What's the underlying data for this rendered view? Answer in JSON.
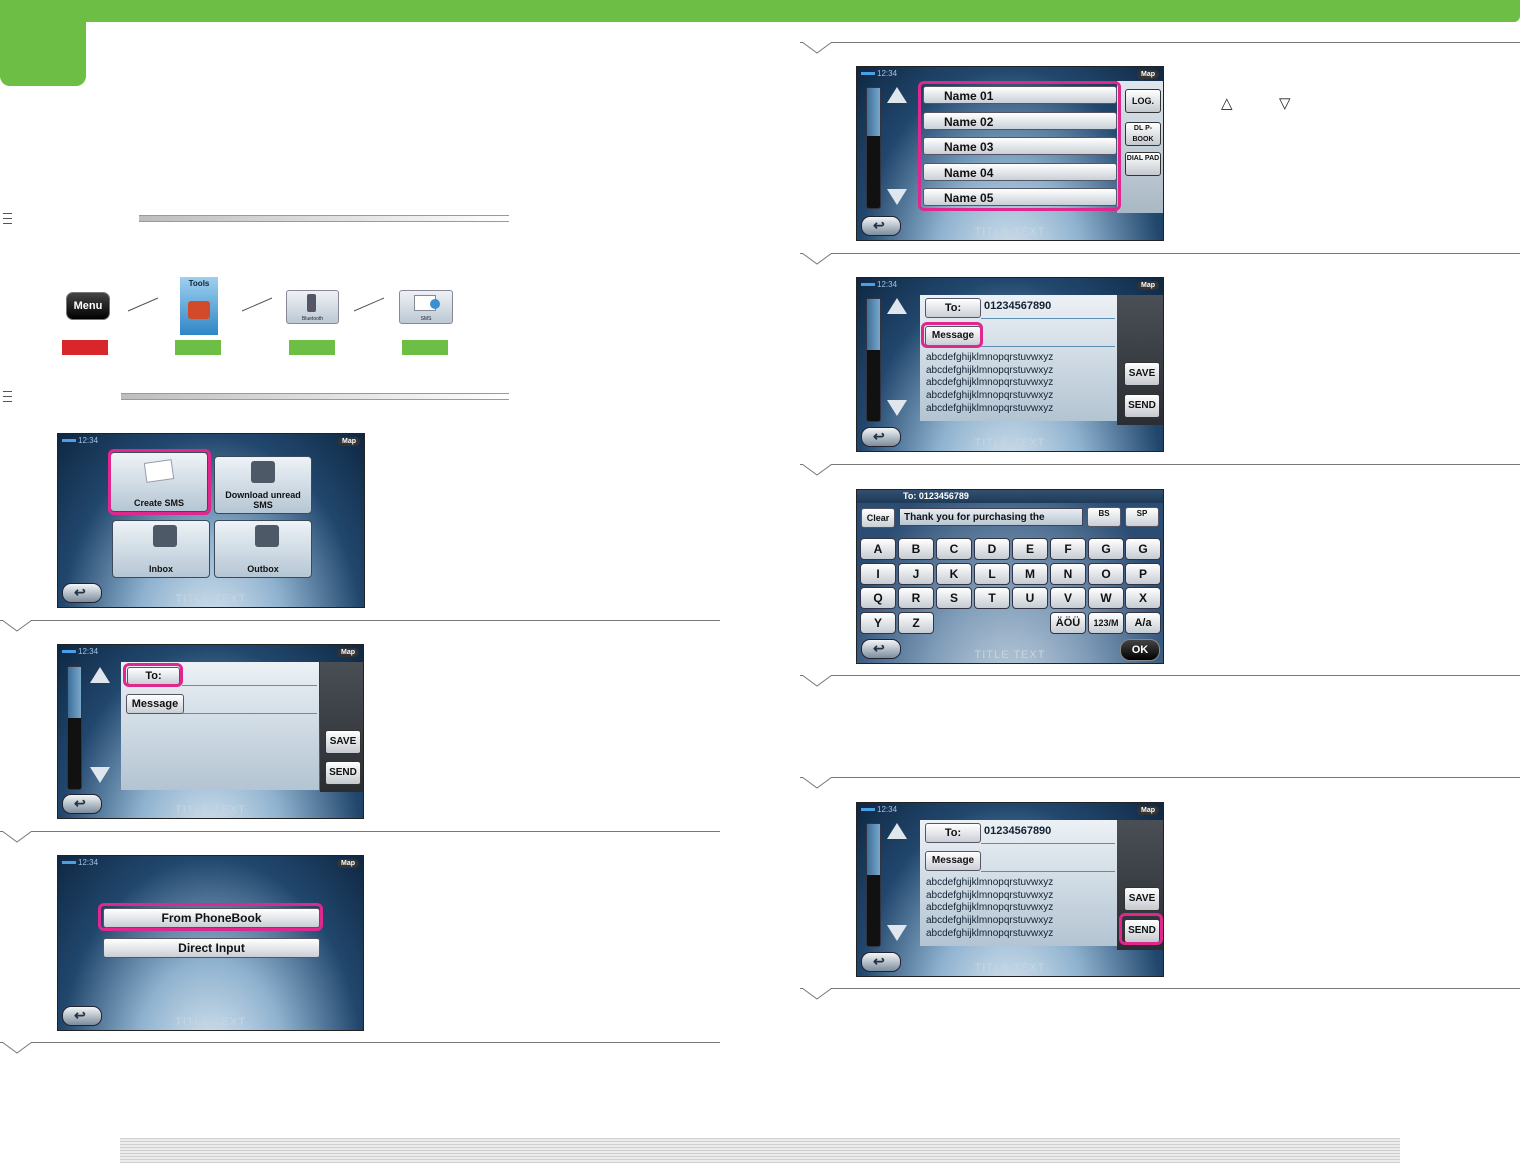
{
  "colors": {
    "accent_green": "#6cbe45",
    "accent_red": "#d9262b",
    "highlight": "#e0278e"
  },
  "nav": {
    "menu_label": "Menu",
    "tools_label": "Tools",
    "bluetooth_label": "Bluetooth",
    "sms_label": "SMS"
  },
  "screen": {
    "time": "12:34",
    "map": "Map",
    "title": "TITLE TEXT"
  },
  "sms_menu": {
    "create": "Create SMS",
    "download": "Download unread SMS",
    "inbox": "Inbox",
    "outbox": "Outbox"
  },
  "compose": {
    "to": "To:",
    "message": "Message",
    "save": "SAVE",
    "send": "SEND",
    "number": "01234567890",
    "text_lines": [
      "abcdefghijklmnopqrstuvwxyz",
      "abcdefghijklmnopqrstuvwxyz",
      "abcdefghijklmnopqrstuvwxyz",
      "abcdefghijklmnopqrstuvwxyz",
      "abcdefghijklmnopqrstuvwxyz"
    ]
  },
  "source": {
    "phonebook": "From PhoneBook",
    "direct": "Direct Input"
  },
  "phonebook": {
    "names": [
      "Name 01",
      "Name 02",
      "Name 03",
      "Name 04",
      "Name 05"
    ],
    "log": "LOG.",
    "dl_pbook": "DL P-BOOK",
    "dial_pad": "DIAL PAD"
  },
  "keyboard": {
    "to_line": "To: 0123456789",
    "clear": "Clear",
    "input": "Thank you for purchasing the",
    "bs": "BS",
    "sp": "SP",
    "row1": [
      "A",
      "B",
      "C",
      "D",
      "E",
      "F",
      "G",
      "G"
    ],
    "row2": [
      "I",
      "J",
      "K",
      "L",
      "M",
      "N",
      "O",
      "P"
    ],
    "row3": [
      "Q",
      "R",
      "S",
      "T",
      "U",
      "V",
      "W",
      "X"
    ],
    "row4a": [
      "Y",
      "Z"
    ],
    "umlaut": "ÄÖÜ",
    "num": "123/M",
    "case": "A/a",
    "ok": "OK"
  },
  "hint_arrows": {
    "up": "△",
    "down": "▽"
  }
}
